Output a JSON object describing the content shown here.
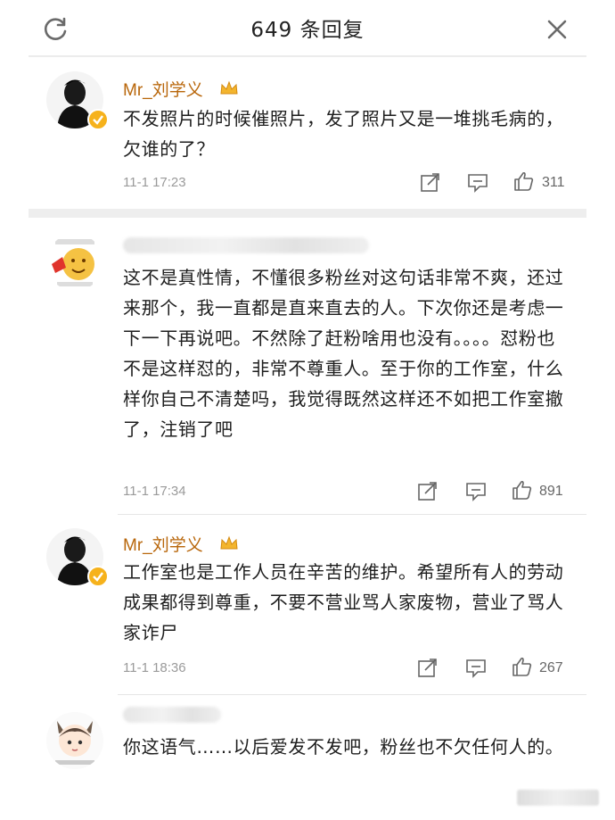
{
  "header": {
    "title": "649 条回复",
    "refresh_icon": "refresh-icon",
    "close_icon": "close-icon"
  },
  "colors": {
    "username": "#b8660a",
    "timestamp": "#9a9a9a",
    "badge": "#f6b21c",
    "separator": "#eeeeee"
  },
  "comments": [
    {
      "username": "Mr_刘学义",
      "text": "不发照片的时候催照片，发了照片又是一堆挑毛病的，欠谁的了？",
      "time": "11-1 17:23",
      "likes": "311"
    },
    {
      "username": "",
      "text": "这不是真性情，不懂很多粉丝对这句话非常不爽，还过来那个，我一直都是直来直去的人。下次你还是考虑一下一下再说吧。不然除了赶粉啥用也没有。。。。怼粉也不是这样怼的，非常不尊重人。至于你的工作室，什么样你自己不清楚吗，我觉得既然这样还不如把工作室撤了，注销了吧",
      "time": "11-1 17:34",
      "likes": "891"
    },
    {
      "username": "Mr_刘学义",
      "text": "工作室也是工作人员在辛苦的维护。希望所有人的劳动成果都得到尊重，不要不营业骂人家废物，营业了骂人家诈尸",
      "time": "11-1 18:36",
      "likes": "267"
    },
    {
      "username": "",
      "text": "你这语气……以后爱发不发吧，粉丝也不欠任何人的。"
    }
  ]
}
